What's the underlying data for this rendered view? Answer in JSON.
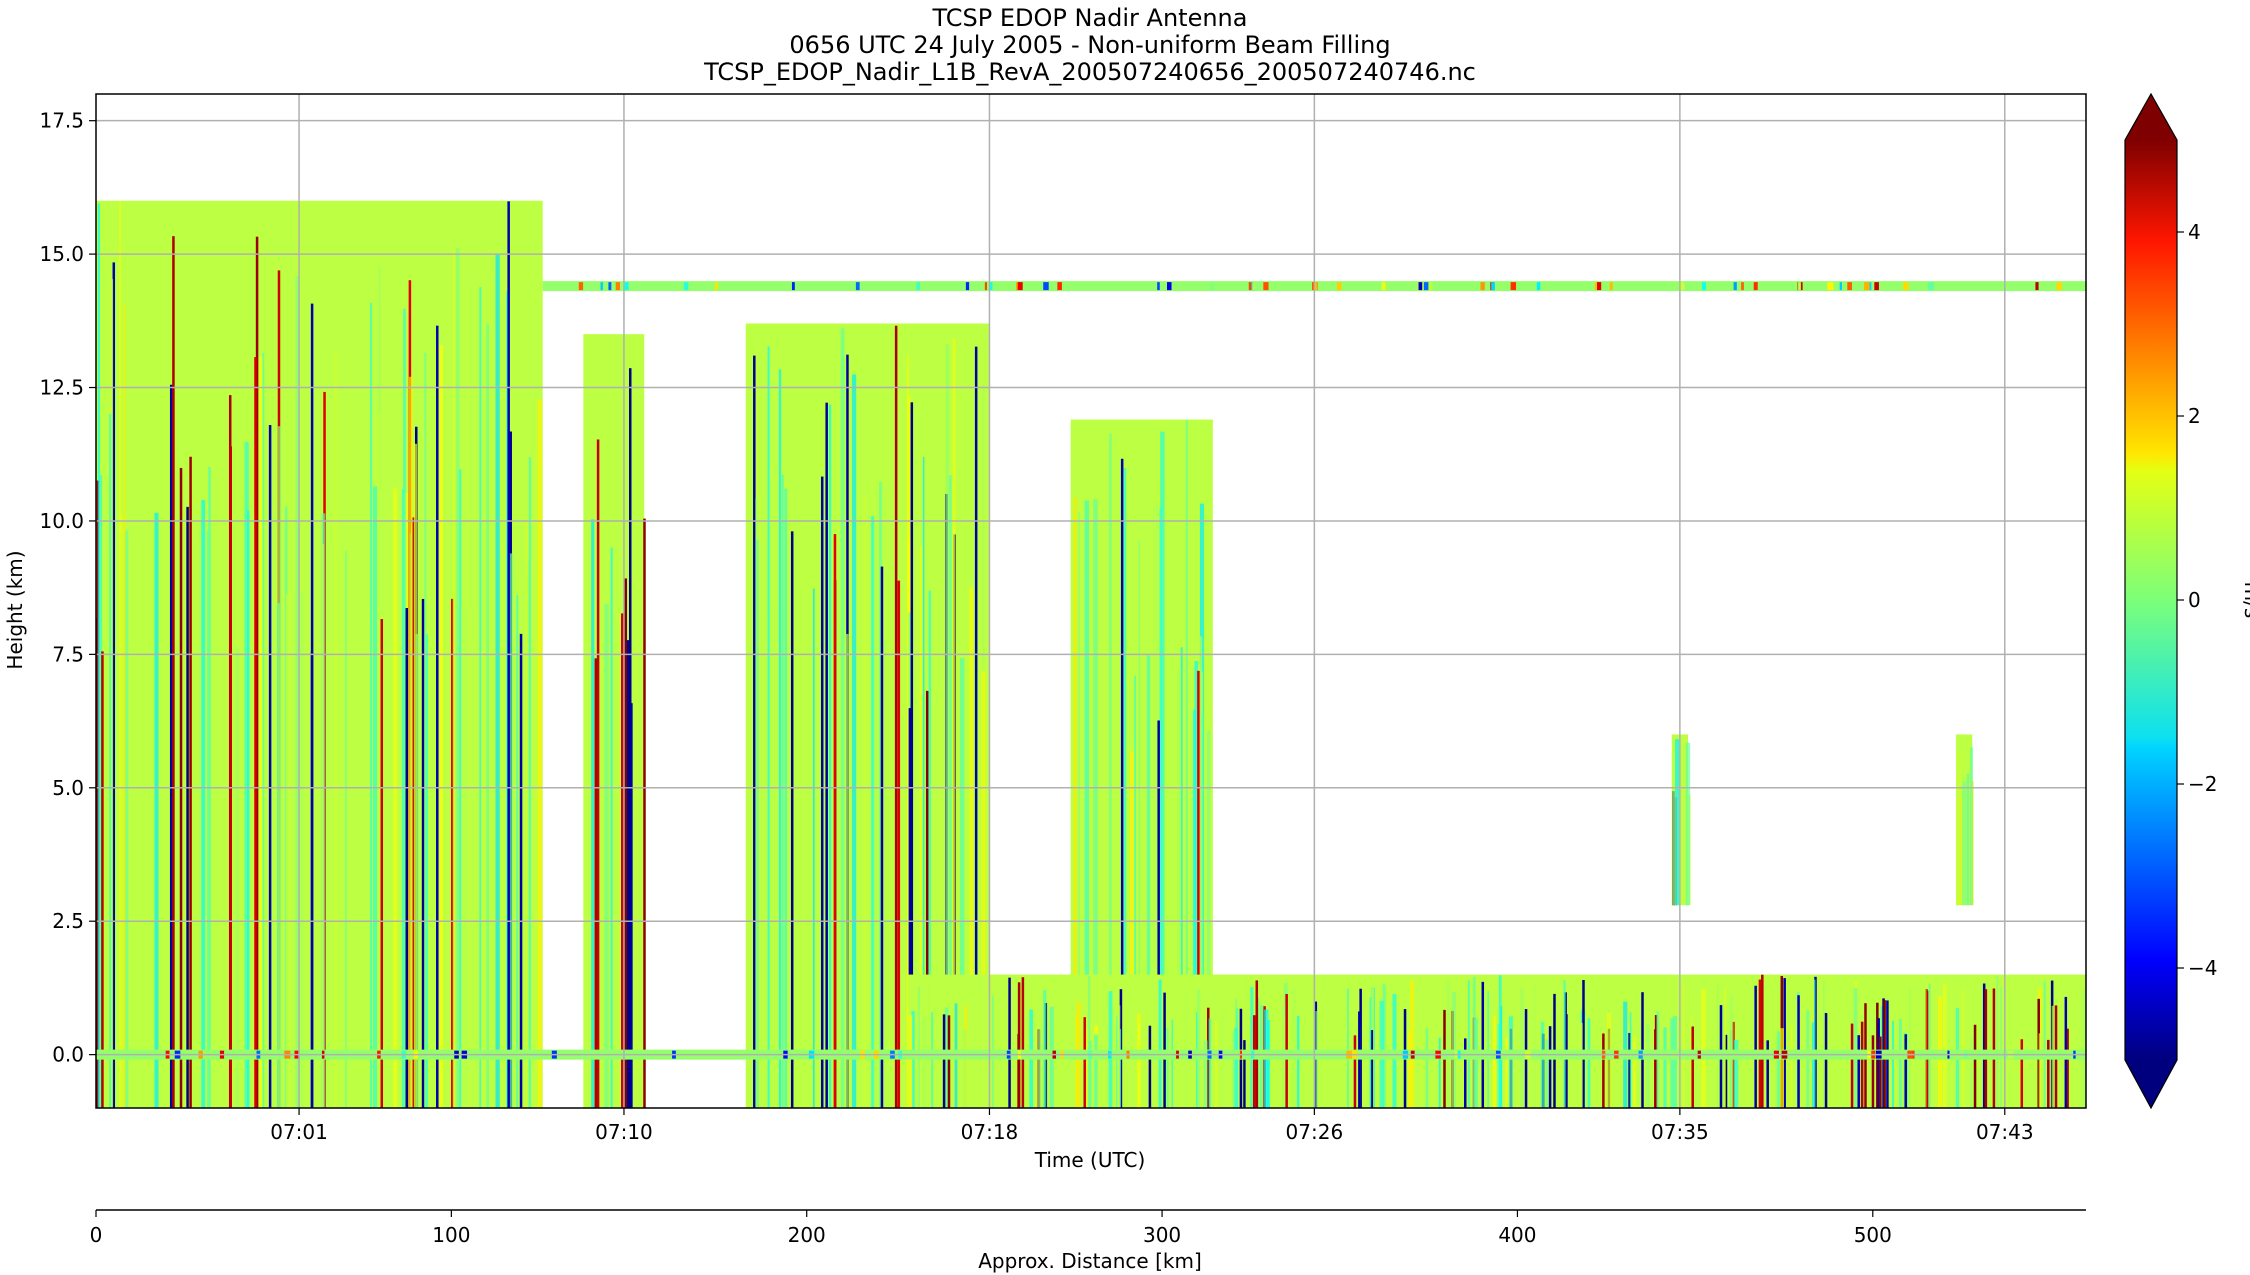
{
  "chart_data": [
    {
      "type": "heatmap",
      "title_lines": [
        "TCSP EDOP Nadir Antenna",
        "0656 UTC 24 July 2005 - Non-uniform Beam Filling",
        "TCSP_EDOP_Nadir_L1B_RevA_200507240656_200507240746.nc"
      ],
      "xlabel": "Time (UTC)",
      "ylabel": "Height (km)",
      "x_unit": "minutes after 06:56 UTC",
      "xlim": [
        0,
        49
      ],
      "ylim": [
        -1.0,
        18.0
      ],
      "x_ticks": [
        {
          "minute": 5,
          "label": "07:01"
        },
        {
          "minute": 13,
          "label": "07:10"
        },
        {
          "minute": 22,
          "label": "07:18"
        },
        {
          "minute": 30,
          "label": "07:26"
        },
        {
          "minute": 39,
          "label": "07:35"
        },
        {
          "minute": 47,
          "label": "07:43"
        }
      ],
      "y_ticks": [
        0.0,
        2.5,
        5.0,
        7.5,
        10.0,
        12.5,
        15.0,
        17.5
      ],
      "y_tick_labels": [
        "0.0",
        "2.5",
        "5.0",
        "7.5",
        "10.0",
        "12.5",
        "15.0",
        "17.5"
      ],
      "grid": true,
      "colorscale": "jet",
      "colorbar": {
        "label": "m/s",
        "range": [
          -5,
          5
        ],
        "ticks": [
          -4,
          -2,
          0,
          2,
          4
        ],
        "tick_labels": [
          "−4",
          "−2",
          "0",
          "2",
          "4"
        ],
        "extend": "both"
      },
      "features": [
        {
          "name": "deep convection (west)",
          "x_range": [
            0,
            11
          ],
          "top_km": 16.0
        },
        {
          "name": "anvil layer",
          "x_range": [
            11,
            49
          ],
          "height_km": 14.4
        },
        {
          "name": "convective tower",
          "x_range": [
            12,
            13.5
          ],
          "top_km": 13.5
        },
        {
          "name": "convective tower",
          "x_range": [
            16,
            22
          ],
          "top_km": 13.7
        },
        {
          "name": "convective cell",
          "x_range": [
            24,
            27.5
          ],
          "top_km": 11.9
        },
        {
          "name": "isolated cell",
          "x_range": [
            38.8,
            39.2
          ],
          "top_km": 6.0
        },
        {
          "name": "isolated cell",
          "x_range": [
            45.8,
            46.2
          ],
          "top_km": 6.0
        },
        {
          "name": "boundary layer echo",
          "x_range": [
            20,
            49
          ],
          "top_km": 1.5
        },
        {
          "name": "surface return",
          "x_range": [
            0,
            49
          ],
          "height_km": 0.0
        }
      ]
    },
    {
      "type": "axis",
      "xlabel": "Approx. Distance [km]",
      "xlim": [
        0,
        560
      ],
      "ticks": [
        0,
        100,
        200,
        300,
        400,
        500
      ],
      "tick_labels": [
        "0",
        "100",
        "200",
        "300",
        "400",
        "500"
      ]
    }
  ]
}
